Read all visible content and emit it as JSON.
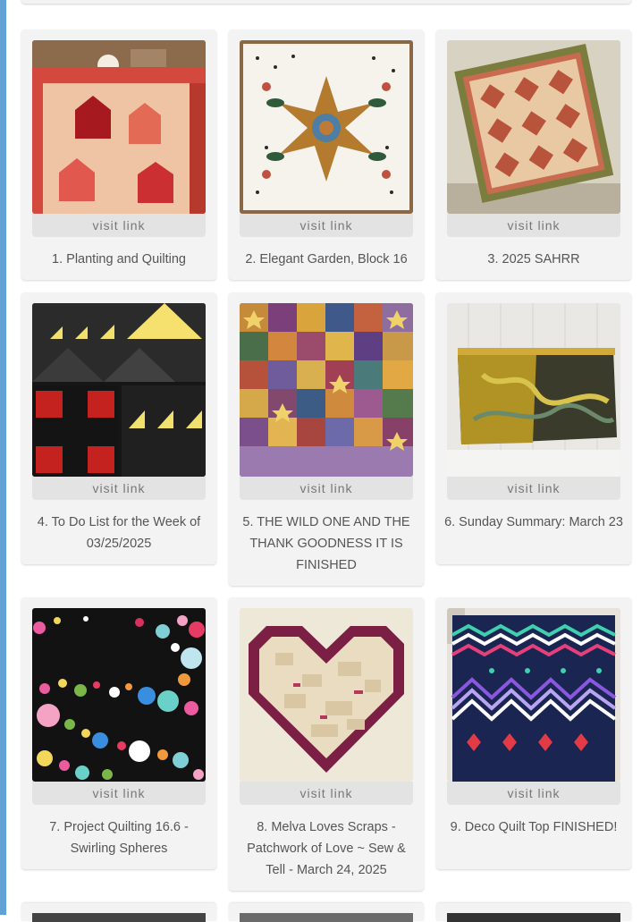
{
  "visit_label": "visit link",
  "items": [
    {
      "caption": "1. Planting and Quilting"
    },
    {
      "caption": "2. Elegant Garden, Block 16"
    },
    {
      "caption": "3. 2025 SAHRR"
    },
    {
      "caption": "4. To Do List for the Week of 03/25/2025"
    },
    {
      "caption": "5. THE WILD ONE AND THE THANK GOODNESS IT IS FINISHED"
    },
    {
      "caption": "6. Sunday Summary: March 23"
    },
    {
      "caption": "7. Project Quilting 16.6 - Swirling Spheres"
    },
    {
      "caption": "8. Melva Loves Scraps - Patchwork of Love ~ Sew & Tell - March 24, 2025"
    },
    {
      "caption": "9. Deco Quilt Top FINISHED!"
    }
  ]
}
